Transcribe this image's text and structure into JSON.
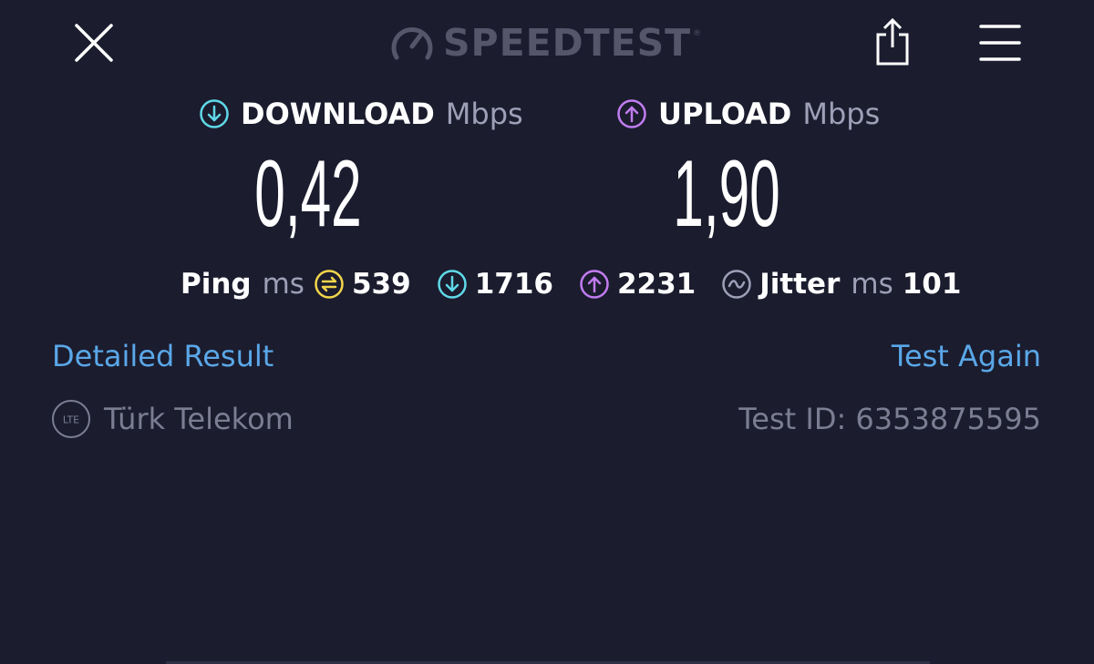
{
  "header": {
    "logo_text": "SPEEDTEST",
    "close_icon": "close-icon",
    "share_icon": "share-icon",
    "menu_icon": "hamburger-menu-icon"
  },
  "download": {
    "label": "DOWNLOAD",
    "unit": "Mbps",
    "value": "0,42",
    "color": "#5fd9e8"
  },
  "upload": {
    "label": "UPLOAD",
    "unit": "Mbps",
    "value": "1,90",
    "color": "#c17cf0"
  },
  "ping": {
    "label": "Ping",
    "unit": "ms",
    "idle": "539",
    "download": "1716",
    "upload": "2231",
    "idle_color": "#f2d64a"
  },
  "jitter": {
    "label": "Jitter",
    "unit": "ms",
    "value": "101"
  },
  "links": {
    "detailed": "Detailed Result",
    "again": "Test Again",
    "color": "#5aa7e8"
  },
  "provider": {
    "badge": "LTE",
    "name": "Türk Telekom"
  },
  "test_id": "Test ID: 6353875595",
  "colors": {
    "background": "#1b1c2e",
    "muted_text": "#7b7d92"
  }
}
